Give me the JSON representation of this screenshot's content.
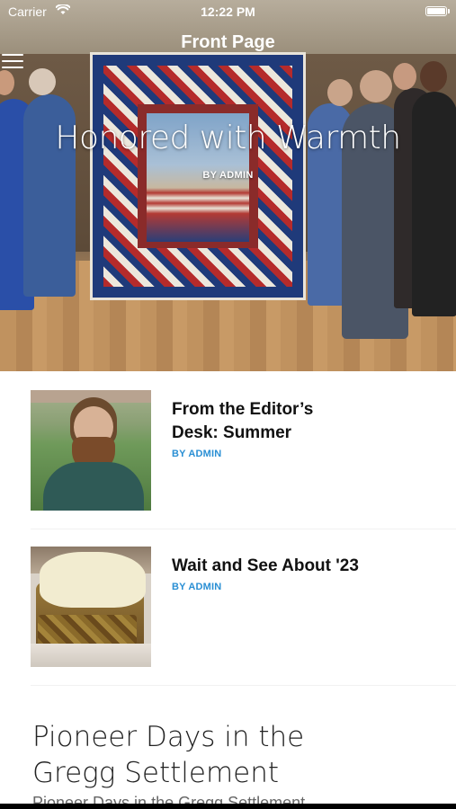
{
  "status_bar": {
    "carrier": "Carrier",
    "time": "12:22 PM"
  },
  "nav": {
    "title": "Front Page"
  },
  "hero": {
    "title": "Honored with Warmth",
    "byline": "BY ADMIN"
  },
  "articles": [
    {
      "title_line1": "From the Editor’s",
      "title_line2": "Desk: Summer",
      "byline": "BY ADMIN"
    },
    {
      "title_line1": "Wait and See About '23",
      "title_line2": "",
      "byline": "BY ADMIN"
    }
  ],
  "feature": {
    "title_line1": "Pioneer Days in the",
    "title_line2": "Gregg Settlement",
    "excerpt": "Pioneer Days in the Gregg Settlement"
  },
  "colors": {
    "byline": "#2a8fd4",
    "title": "#111111"
  }
}
